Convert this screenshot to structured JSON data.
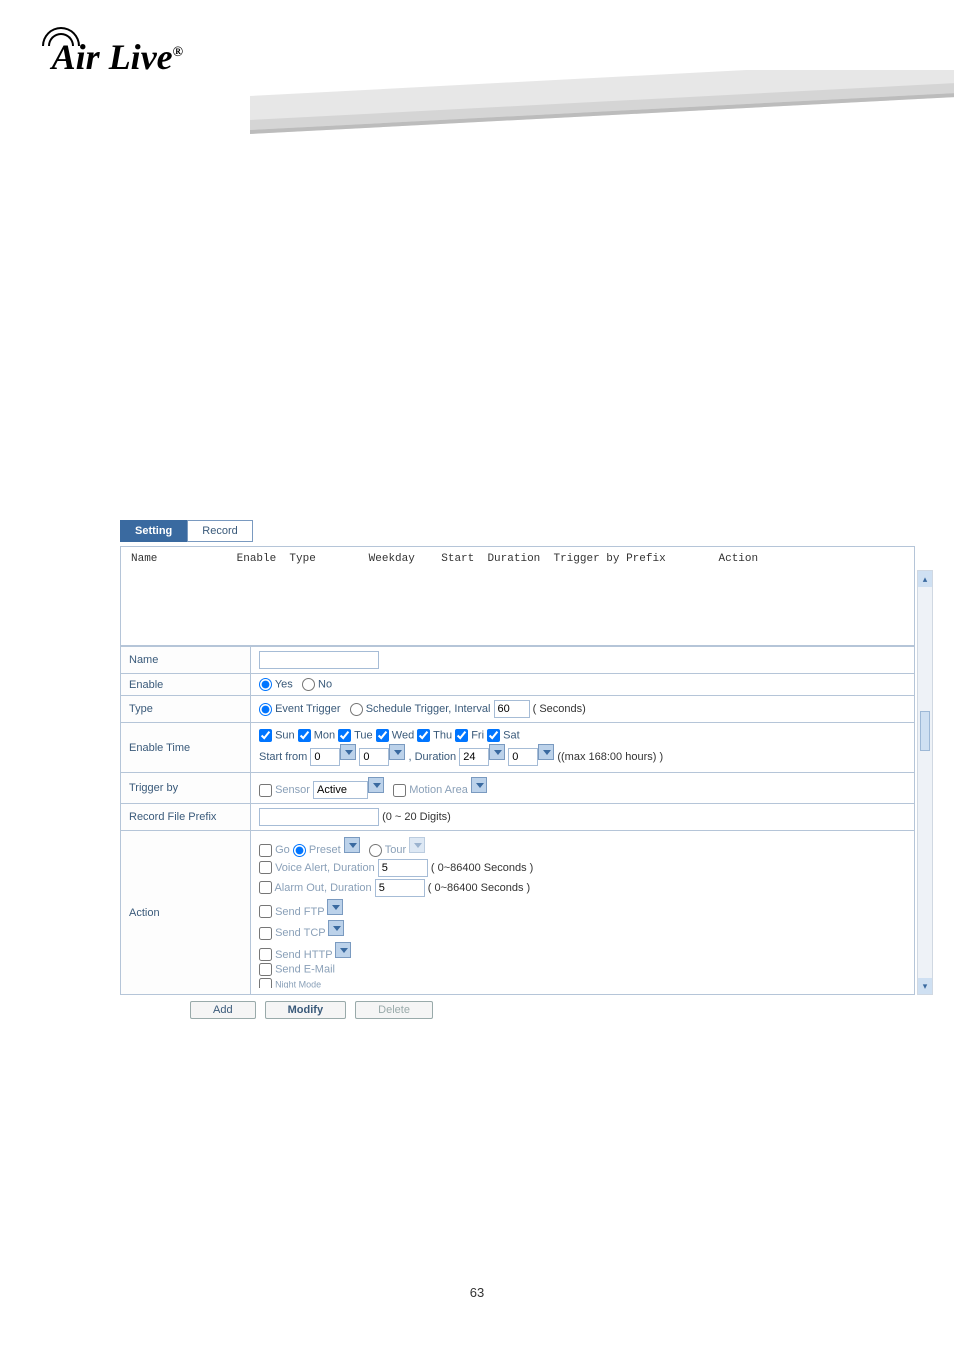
{
  "logo_text": "Air Live",
  "logo_reg": "®",
  "tabs": {
    "setting": "Setting",
    "record": "Record"
  },
  "list_header": "Name            Enable  Type        Weekday    Start  Duration  Trigger by Prefix        Action",
  "rows": {
    "name": "Name",
    "enable": "Enable",
    "type": "Type",
    "enable_time": "Enable Time",
    "trigger_by": "Trigger by",
    "record_prefix": "Record File Prefix",
    "action": "Action"
  },
  "enable_opts": {
    "yes": "Yes",
    "no": "No"
  },
  "type_opts": {
    "event": "Event Trigger",
    "schedule": "Schedule Trigger, Interval",
    "interval_val": "60",
    "seconds": "( Seconds)"
  },
  "days": {
    "sun": "Sun",
    "mon": "Mon",
    "tue": "Tue",
    "wed": "Wed",
    "thu": "Thu",
    "fri": "Fri",
    "sat": "Sat"
  },
  "enable_time": {
    "start_from": "Start from",
    "h1": "0",
    "m1": "0",
    "duration_lbl": "Duration",
    "h2": "24",
    "m2": "0",
    "max": "((max 168:00 hours) )"
  },
  "trigger": {
    "sensor": "Sensor",
    "sensor_val": "Active",
    "motion": "Motion Area"
  },
  "prefix": {
    "hint": "(0 ~ 20 Digits)"
  },
  "action": {
    "go": "Go",
    "preset": "Preset",
    "tour": "Tour",
    "voice": "Voice Alert, Duration",
    "voice_val": "5",
    "voice_hint": "( 0~86400 Seconds )",
    "alarm": "Alarm Out, Duration",
    "alarm_val": "5",
    "alarm_hint": "( 0~86400 Seconds )",
    "ftp": "Send FTP",
    "tcp": "Send TCP",
    "http": "Send HTTP",
    "email": "Send E-Mail",
    "frag": "Night Mode"
  },
  "buttons": {
    "add": "Add",
    "modify": "Modify",
    "delete": "Delete"
  },
  "page": "63"
}
